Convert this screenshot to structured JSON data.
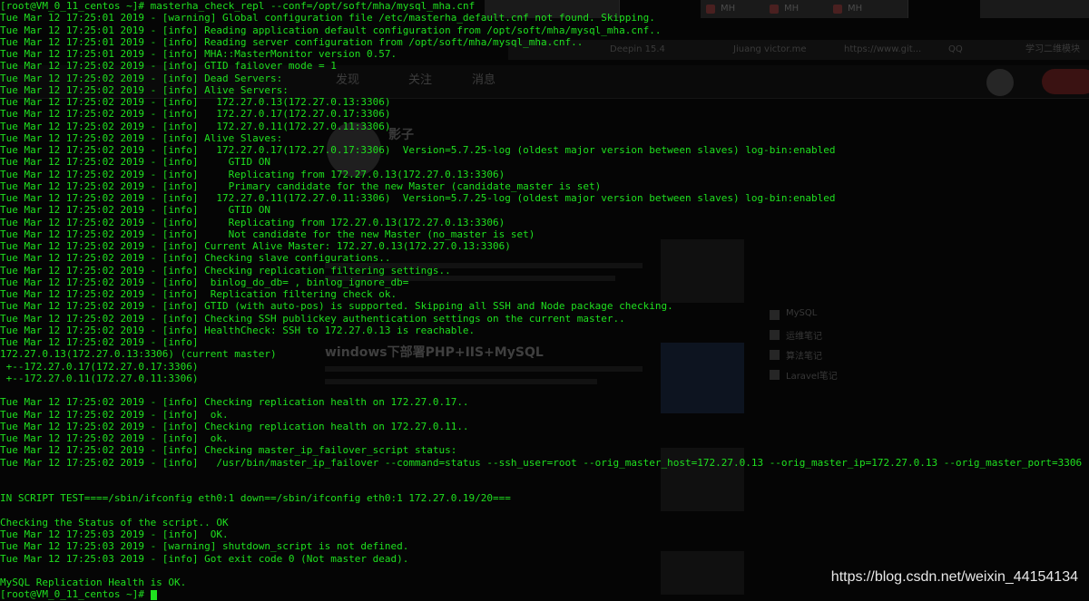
{
  "colors": {
    "terminal_text": "#1fe01f",
    "background": "#050505",
    "watermark": "#e8e8e8"
  },
  "terminal": {
    "prompt": "[root@VM_0_11_centos ~]# ",
    "command": "masterha_check_repl --conf=/opt/soft/mha/mysql_mha.cnf",
    "lines": [
      "Tue Mar 12 17:25:01 2019 - [warning] Global configuration file /etc/masterha_default.cnf not found. Skipping.",
      "Tue Mar 12 17:25:01 2019 - [info] Reading application default configuration from /opt/soft/mha/mysql_mha.cnf..",
      "Tue Mar 12 17:25:01 2019 - [info] Reading server configuration from /opt/soft/mha/mysql_mha.cnf..",
      "Tue Mar 12 17:25:01 2019 - [info] MHA::MasterMonitor version 0.57.",
      "Tue Mar 12 17:25:02 2019 - [info] GTID failover mode = 1",
      "Tue Mar 12 17:25:02 2019 - [info] Dead Servers:",
      "Tue Mar 12 17:25:02 2019 - [info] Alive Servers:",
      "Tue Mar 12 17:25:02 2019 - [info]   172.27.0.13(172.27.0.13:3306)",
      "Tue Mar 12 17:25:02 2019 - [info]   172.27.0.17(172.27.0.17:3306)",
      "Tue Mar 12 17:25:02 2019 - [info]   172.27.0.11(172.27.0.11:3306)",
      "Tue Mar 12 17:25:02 2019 - [info] Alive Slaves:",
      "Tue Mar 12 17:25:02 2019 - [info]   172.27.0.17(172.27.0.17:3306)  Version=5.7.25-log (oldest major version between slaves) log-bin:enabled",
      "Tue Mar 12 17:25:02 2019 - [info]     GTID ON",
      "Tue Mar 12 17:25:02 2019 - [info]     Replicating from 172.27.0.13(172.27.0.13:3306)",
      "Tue Mar 12 17:25:02 2019 - [info]     Primary candidate for the new Master (candidate_master is set)",
      "Tue Mar 12 17:25:02 2019 - [info]   172.27.0.11(172.27.0.11:3306)  Version=5.7.25-log (oldest major version between slaves) log-bin:enabled",
      "Tue Mar 12 17:25:02 2019 - [info]     GTID ON",
      "Tue Mar 12 17:25:02 2019 - [info]     Replicating from 172.27.0.13(172.27.0.13:3306)",
      "Tue Mar 12 17:25:02 2019 - [info]     Not candidate for the new Master (no_master is set)",
      "Tue Mar 12 17:25:02 2019 - [info] Current Alive Master: 172.27.0.13(172.27.0.13:3306)",
      "Tue Mar 12 17:25:02 2019 - [info] Checking slave configurations..",
      "Tue Mar 12 17:25:02 2019 - [info] Checking replication filtering settings..",
      "Tue Mar 12 17:25:02 2019 - [info]  binlog_do_db= , binlog_ignore_db=",
      "Tue Mar 12 17:25:02 2019 - [info]  Replication filtering check ok.",
      "Tue Mar 12 17:25:02 2019 - [info] GTID (with auto-pos) is supported. Skipping all SSH and Node package checking.",
      "Tue Mar 12 17:25:02 2019 - [info] Checking SSH publickey authentication settings on the current master..",
      "Tue Mar 12 17:25:02 2019 - [info] HealthCheck: SSH to 172.27.0.13 is reachable.",
      "Tue Mar 12 17:25:02 2019 - [info]",
      "172.27.0.13(172.27.0.13:3306) (current master)",
      " +--172.27.0.17(172.27.0.17:3306)",
      " +--172.27.0.11(172.27.0.11:3306)",
      "",
      "Tue Mar 12 17:25:02 2019 - [info] Checking replication health on 172.27.0.17..",
      "Tue Mar 12 17:25:02 2019 - [info]  ok.",
      "Tue Mar 12 17:25:02 2019 - [info] Checking replication health on 172.27.0.11..",
      "Tue Mar 12 17:25:02 2019 - [info]  ok.",
      "Tue Mar 12 17:25:02 2019 - [info] Checking master_ip_failover_script status:",
      "Tue Mar 12 17:25:02 2019 - [info]   /usr/bin/master_ip_failover --command=status --ssh_user=root --orig_master_host=172.27.0.13 --orig_master_ip=172.27.0.13 --orig_master_port=3306",
      "",
      "",
      "IN SCRIPT TEST====/sbin/ifconfig eth0:1 down==/sbin/ifconfig eth0:1 172.27.0.19/20===",
      "",
      "Checking the Status of the script.. OK",
      "Tue Mar 12 17:25:03 2019 - [info]  OK.",
      "Tue Mar 12 17:25:03 2019 - [warning] shutdown_script is not defined.",
      "Tue Mar 12 17:25:03 2019 - [info] Got exit code 0 (Not master dead).",
      "",
      "MySQL Replication Health is OK.",
      "[root@VM_0_11_centos ~]# "
    ]
  },
  "background_page": {
    "tabs": [
      "MH",
      "MH",
      "MH"
    ],
    "bookmarks": [
      "Deepin 15.4",
      "Jiuang victor.me",
      "https://www.git...",
      "QQ",
      "学习二维模块"
    ],
    "toolbar": {
      "publish": "发现",
      "follow": "关注",
      "messages": "消息"
    },
    "author_name": "影子",
    "article_title": "windows下部署PHP+IIS+MySQL",
    "sidebar_items": [
      "MySQL",
      "运维笔记",
      "算法笔记",
      "Laravel笔记"
    ]
  },
  "watermark": "https://blog.csdn.net/weixin_44154134"
}
